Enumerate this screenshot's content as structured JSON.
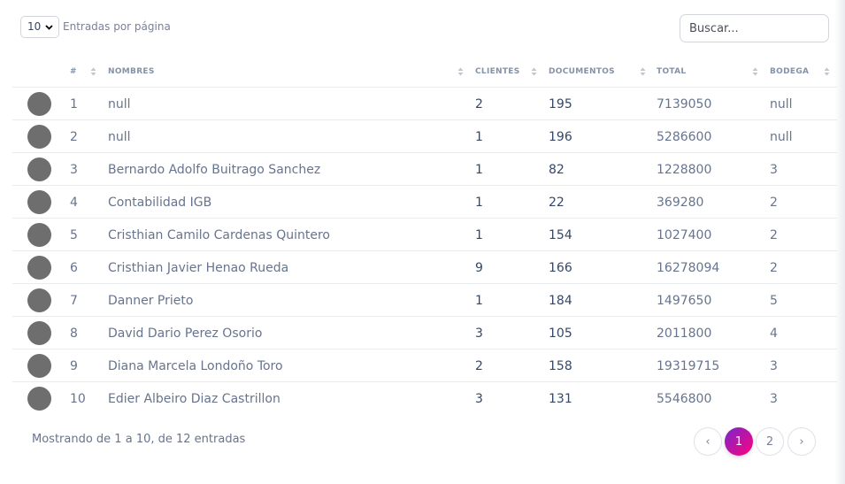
{
  "toolbar": {
    "per_page_value": "10",
    "per_page_label": "Entradas por página",
    "search_placeholder": "Buscar..."
  },
  "table": {
    "headers": {
      "num": "#",
      "nombres": "NOMBRES",
      "clientes": "CLIENTES",
      "documentos": "DOCUMENTOS",
      "total": "TOTAL",
      "bodega": "BODEGA"
    },
    "rows": [
      {
        "num": "1",
        "nombre": "null",
        "clientes": "2",
        "documentos": "195",
        "total": "7139050",
        "bodega": "null"
      },
      {
        "num": "2",
        "nombre": "null",
        "clientes": "1",
        "documentos": "196",
        "total": "5286600",
        "bodega": "null"
      },
      {
        "num": "3",
        "nombre": "Bernardo Adolfo Buitrago Sanchez",
        "clientes": "1",
        "documentos": "82",
        "total": "1228800",
        "bodega": "3"
      },
      {
        "num": "4",
        "nombre": "Contabilidad IGB",
        "clientes": "1",
        "documentos": "22",
        "total": "369280",
        "bodega": "2"
      },
      {
        "num": "5",
        "nombre": "Cristhian Camilo Cardenas Quintero",
        "clientes": "1",
        "documentos": "154",
        "total": "1027400",
        "bodega": "2"
      },
      {
        "num": "6",
        "nombre": "Cristhian Javier Henao Rueda",
        "clientes": "9",
        "documentos": "166",
        "total": "16278094",
        "bodega": "2"
      },
      {
        "num": "7",
        "nombre": "Danner Prieto",
        "clientes": "1",
        "documentos": "184",
        "total": "1497650",
        "bodega": "5"
      },
      {
        "num": "8",
        "nombre": "David Dario Perez Osorio",
        "clientes": "3",
        "documentos": "105",
        "total": "2011800",
        "bodega": "4"
      },
      {
        "num": "9",
        "nombre": "Diana Marcela Londoño Toro",
        "clientes": "2",
        "documentos": "158",
        "total": "19319715",
        "bodega": "3"
      },
      {
        "num": "10",
        "nombre": "Edier Albeiro Diaz Castrillon",
        "clientes": "3",
        "documentos": "131",
        "total": "5546800",
        "bodega": "3"
      }
    ]
  },
  "footer": {
    "info": "Mostrando de 1 a 10, de 12 entradas",
    "prev": "‹",
    "pages": [
      "1",
      "2"
    ],
    "next": "›",
    "active_page": "1"
  },
  "colors": {
    "accent_gradient_start": "#7928ca",
    "accent_gradient_end": "#ff0080",
    "avatar": "#6e6e6e"
  }
}
